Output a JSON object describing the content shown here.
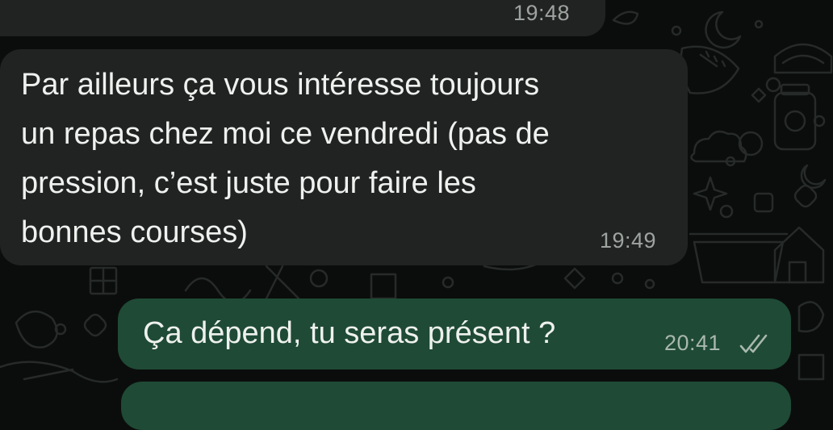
{
  "messages": [
    {
      "direction": "incoming",
      "time": "19:48"
    },
    {
      "direction": "incoming",
      "lines": [
        "Par ailleurs ça vous intéresse toujours",
        "un repas chez moi ce vendredi (pas de",
        "pression, c’est juste pour faire les",
        "bonnes courses)"
      ],
      "time": "19:49"
    },
    {
      "direction": "outgoing",
      "text": "Ça dépend, tu seras présent ?",
      "time": "20:41",
      "status_icon": "double-check-icon"
    }
  ],
  "colors": {
    "background": "#0b0d0c",
    "incoming_bubble": "#202322",
    "outgoing_bubble": "#1f4a36",
    "text": "#eef1ee",
    "timestamp": "#9fa3a0"
  }
}
